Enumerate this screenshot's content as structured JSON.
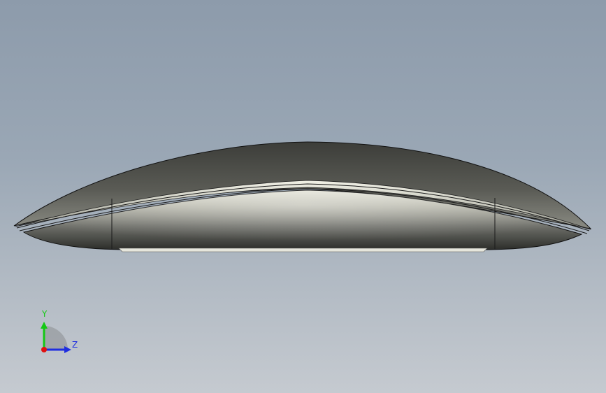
{
  "viewport": {
    "background_top": "#8d9bab",
    "background_bottom": "#c5cad0"
  },
  "model": {
    "name_icon": "mouse-model-side-view",
    "body_color": "#6b6c66",
    "highlight_color": "#d8d8cc"
  },
  "triad": {
    "y_label": "Y",
    "z_label": "Z",
    "y_color": "#14c814",
    "z_color": "#1e2de0",
    "x_color": "#e01010"
  }
}
